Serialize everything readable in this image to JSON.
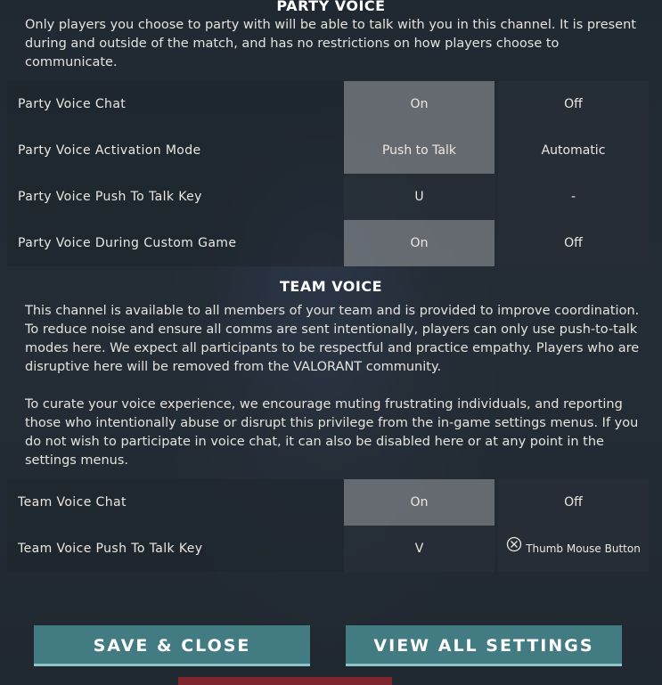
{
  "party_voice": {
    "title": "PARTY VOICE",
    "description": "Only players you choose to party with will be able to talk with you in this channel. It is present during and outside of the match, and has no restrictions on how players choose to communicate.",
    "rows": [
      {
        "label": "Party Voice Chat",
        "option_a": "On",
        "option_b": "Off",
        "selected": "a"
      },
      {
        "label": "Party Voice Activation Mode",
        "option_a": "Push to Talk",
        "option_b": "Automatic",
        "selected": "a"
      },
      {
        "label": "Party Voice Push To Talk Key",
        "option_a": "U",
        "option_b": "-",
        "selected": "none"
      },
      {
        "label": "Party Voice During Custom Game",
        "option_a": "On",
        "option_b": "Off",
        "selected": "a"
      }
    ]
  },
  "team_voice": {
    "title": "TEAM VOICE",
    "description_1": "This channel is available to all members of your team and is provided to improve coordination. To reduce noise and ensure all comms are sent intentionally, players can only use push-to-talk modes here. We expect all participants to be respectful and practice empathy.  Players who are disruptive here will be removed from the VALORANT community.",
    "description_2": "To curate your voice experience, we encourage muting frustrating individuals, and reporting those who intentionally abuse or disrupt this privilege from the in-game settings menus. If you do not wish to participate in voice chat, it can also be disabled here or at any point in the settings menus.",
    "rows": [
      {
        "label": "Team Voice Chat",
        "option_a": "On",
        "option_b": "Off",
        "selected": "a"
      },
      {
        "label": "Team Voice Push To Talk Key",
        "option_a": "V",
        "option_b": "Thumb Mouse Button",
        "selected": "none"
      }
    ]
  },
  "buttons": {
    "save_close": "SAVE & CLOSE",
    "view_all": "VIEW ALL SETTINGS"
  },
  "icons": {
    "mouse_button": "mouse-thumb-button-icon"
  },
  "colors": {
    "button_bg": "#437b82",
    "button_underline": "#8fc5c9",
    "selected_option": "#787c82"
  }
}
